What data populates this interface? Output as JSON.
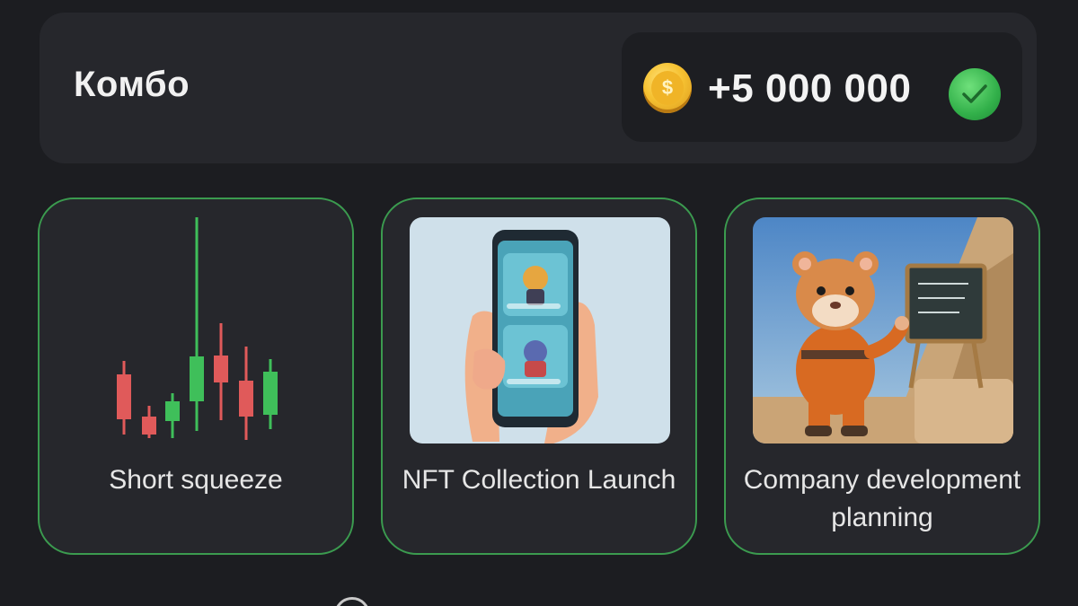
{
  "combo": {
    "title": "Комбо",
    "reward": "+5 000 000",
    "coin_icon": "coin-icon",
    "coin_symbol": "$",
    "status_icon": "check-icon"
  },
  "cards": [
    {
      "label": "Short squeeze",
      "image": "candlestick-chart-icon"
    },
    {
      "label": "NFT Collection Launch",
      "image": "phone-in-hand-image"
    },
    {
      "label": "Company development planning",
      "image": "hamster-with-board-image"
    }
  ],
  "colors": {
    "background": "#1c1d21",
    "panel": "#26272c",
    "accent_green": "#3b9b4f",
    "candle_red": "#e05a5a",
    "candle_green": "#3fbf5a",
    "coin_gold": "#f6c232"
  }
}
